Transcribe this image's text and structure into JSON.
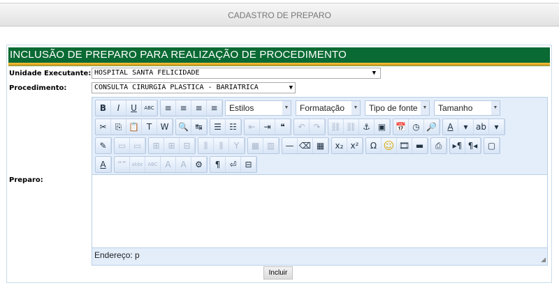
{
  "header": {
    "title": "CADASTRO DE PREPARO"
  },
  "form": {
    "title": "INCLUSÃO DE PREPARO PARA REALIZAÇÃO DE PROCEDIMENTO",
    "unidade_label": "Unidade Executante:",
    "unidade_value": "HOSPITAL SANTA FELICIDADE",
    "procedimento_label": "Procedimento:",
    "procedimento_value": "CONSULTA CIRURGIA PLASTICA - BARIATRICA",
    "preparo_label": "Preparo:",
    "submit_label": "Incluir"
  },
  "editor": {
    "combos": [
      "Estilos",
      "Formatação",
      "Tipo de fonte",
      "Tamanho"
    ],
    "status": "Endereço: p",
    "rows": [
      [
        [
          [
            "bold",
            "B",
            0
          ],
          [
            "italic",
            "I",
            0
          ],
          [
            "underline",
            "U",
            0
          ],
          [
            "strikethrough",
            "ABC",
            0
          ]
        ],
        [
          [
            "align-left",
            "≡",
            0
          ],
          [
            "align-center",
            "≡",
            0
          ],
          [
            "align-right",
            "≡",
            0
          ],
          [
            "align-justify",
            "≡",
            0
          ]
        ]
      ],
      [
        [
          [
            "cut",
            "✂",
            0
          ],
          [
            "copy",
            "⎘",
            0
          ],
          [
            "paste",
            "📋",
            0
          ],
          [
            "paste-text",
            "T",
            0
          ],
          [
            "paste-word",
            "W",
            0
          ]
        ],
        [
          [
            "find",
            "🔍",
            0
          ],
          [
            "replace",
            "↹",
            0
          ]
        ],
        [
          [
            "bulleted-list",
            "☰",
            0
          ],
          [
            "numbered-list",
            "☷",
            0
          ]
        ],
        [
          [
            "outdent",
            "⇤",
            1
          ],
          [
            "indent",
            "⇥",
            0
          ],
          [
            "blockquote",
            "❝",
            0
          ]
        ],
        [
          [
            "undo",
            "↶",
            1
          ],
          [
            "redo",
            "↷",
            1
          ]
        ],
        [
          [
            "link",
            "⛓",
            1
          ],
          [
            "unlink",
            "⛓",
            1
          ],
          [
            "anchor",
            "⚓",
            0
          ],
          [
            "image",
            "▣",
            0
          ]
        ],
        [
          [
            "date",
            "📅",
            0
          ],
          [
            "time",
            "◷",
            0
          ],
          [
            "preview",
            "🔎",
            0
          ]
        ],
        [
          [
            "text-color",
            "A",
            0
          ],
          [
            "text-color-dropdown",
            "▾",
            0
          ],
          [
            "background-color",
            "ab",
            0
          ],
          [
            "background-color-dropdown",
            "▾",
            0
          ]
        ]
      ],
      [
        [
          [
            "edit-form",
            "✎",
            0
          ]
        ],
        [
          [
            "table-row",
            "▭",
            1
          ],
          [
            "table-cell",
            "▭",
            1
          ]
        ],
        [
          [
            "insert-row-before",
            "⊞",
            1
          ],
          [
            "insert-row-after",
            "⊞",
            1
          ],
          [
            "delete-row",
            "⊟",
            1
          ]
        ],
        [
          [
            "insert-col-before",
            "⫼",
            1
          ],
          [
            "insert-col-after",
            "⫼",
            1
          ],
          [
            "delete-col",
            "Y",
            1
          ]
        ],
        [
          [
            "merge-cells",
            "▦",
            1
          ],
          [
            "split-cell",
            "▥",
            1
          ]
        ],
        [
          [
            "horizontal-rule",
            "—",
            0
          ],
          [
            "eraser",
            "⌫",
            0
          ],
          [
            "table",
            "▦",
            0
          ]
        ],
        [
          [
            "subscript",
            "x₂",
            0
          ],
          [
            "superscript",
            "x²",
            0
          ]
        ],
        [
          [
            "special-char",
            "Ω",
            0
          ],
          [
            "smiley",
            "☺",
            0
          ],
          [
            "media",
            "🎞",
            0
          ],
          [
            "input-field",
            "▬",
            0
          ]
        ],
        [
          [
            "print",
            "⎙",
            0
          ]
        ],
        [
          [
            "ltr",
            "▸¶",
            0
          ],
          [
            "rtl",
            "¶◂",
            0
          ]
        ],
        [
          [
            "fullscreen",
            "▢",
            0
          ]
        ]
      ],
      [
        [
          [
            "styles",
            "A",
            0
          ]
        ],
        [
          [
            "cite",
            "“”",
            1
          ],
          [
            "abbr",
            "abbr",
            1
          ],
          [
            "acronym",
            "ABC",
            1
          ],
          [
            "delete-text",
            "A",
            1
          ],
          [
            "insert-text",
            "A",
            1
          ],
          [
            "attributes",
            "⚙",
            0
          ]
        ],
        [
          [
            "show-blocks",
            "¶",
            0
          ],
          [
            "non-breaking",
            "⏎",
            0
          ],
          [
            "page-break",
            "⊟",
            0
          ]
        ]
      ]
    ]
  }
}
